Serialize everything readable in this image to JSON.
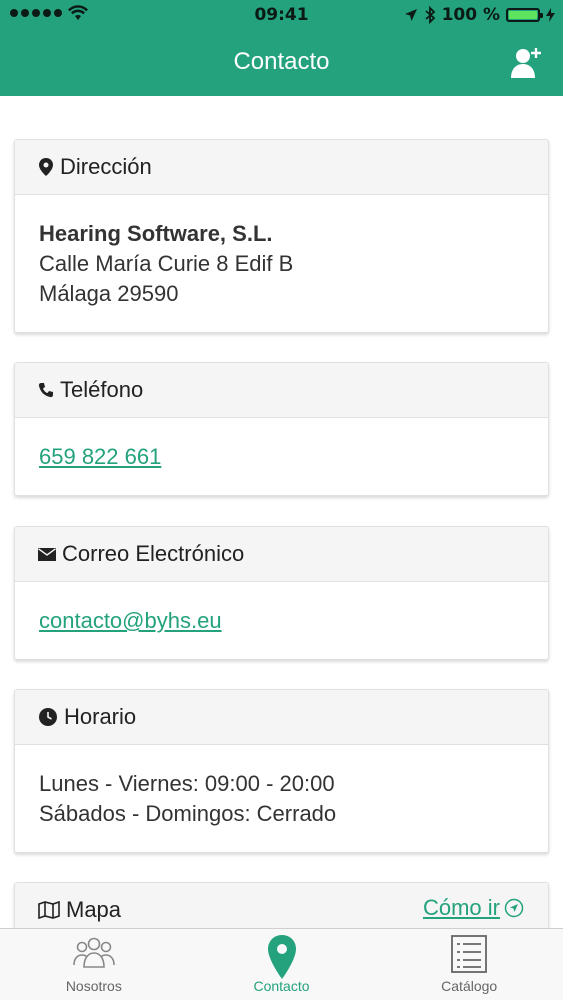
{
  "status_bar": {
    "time": "09:41",
    "battery": "100 %"
  },
  "nav": {
    "title": "Contacto",
    "action_icon": "add-contact-icon"
  },
  "cards": {
    "address": {
      "title": "Dirección",
      "icon": "location-pin-icon",
      "company": "Hearing Software, S.L.",
      "street": "Calle María Curie 8 Edif B",
      "city": "Málaga 29590"
    },
    "phone": {
      "title": "Teléfono",
      "icon": "phone-icon",
      "number": "659 822 661"
    },
    "email": {
      "title": "Correo Electrónico",
      "icon": "envelope-icon",
      "address": "contacto@byhs.eu"
    },
    "hours": {
      "title": "Horario",
      "icon": "clock-icon",
      "weekdays": "Lunes - Viernes: 09:00 - 20:00",
      "weekend": "Sábados - Domingos: Cerrado"
    },
    "map": {
      "title": "Mapa",
      "icon": "map-icon",
      "directions_label": "Cómo ir"
    }
  },
  "tabs": [
    {
      "label": "Nosotros",
      "icon": "users-icon",
      "active": false
    },
    {
      "label": "Contacto",
      "icon": "location-pin-icon",
      "active": true
    },
    {
      "label": "Catálogo",
      "icon": "list-icon",
      "active": false
    }
  ],
  "colors": {
    "accent": "#23a27d",
    "battery": "#5ee35e"
  }
}
